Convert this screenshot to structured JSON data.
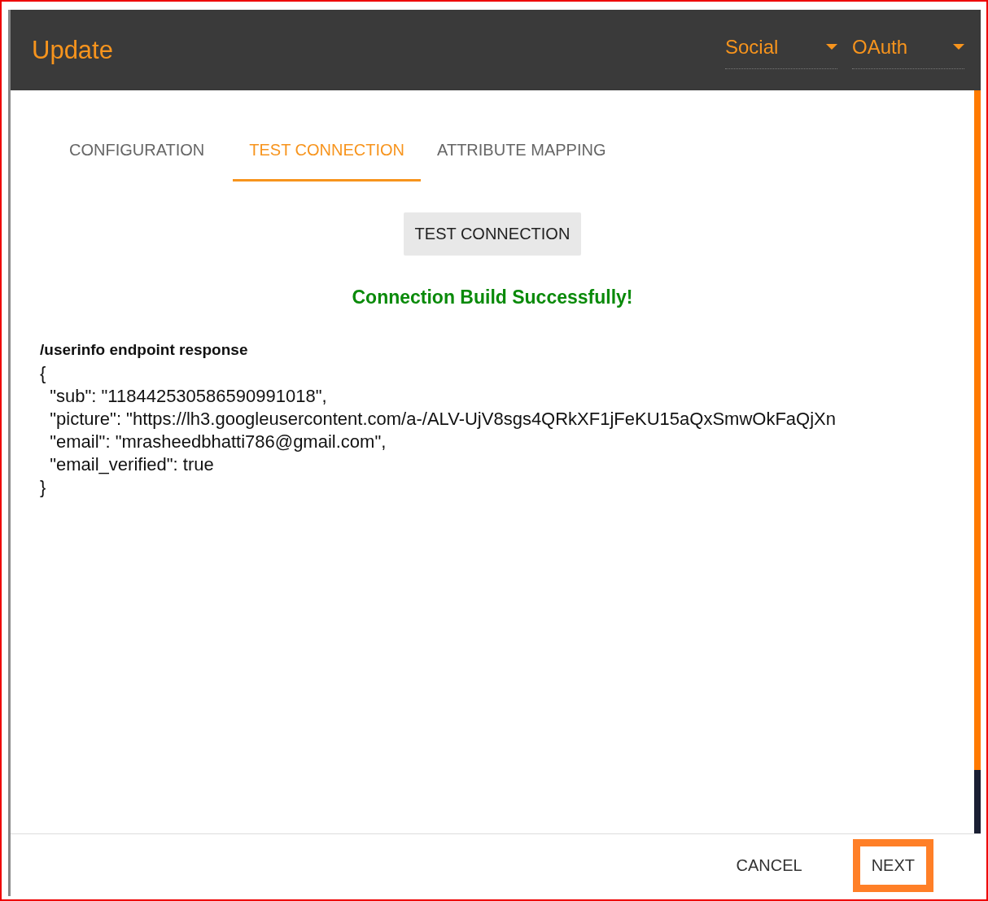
{
  "header": {
    "title": "Update",
    "dropdowns": [
      {
        "value": "Social"
      },
      {
        "value": "OAuth"
      }
    ]
  },
  "tabs": [
    {
      "label": "CONFIGURATION",
      "selected": false
    },
    {
      "label": "TEST CONNECTION",
      "selected": true
    },
    {
      "label": "ATTRIBUTE MAPPING",
      "selected": false
    }
  ],
  "test_button": "TEST CONNECTION",
  "status": "Connection Build Successfully!",
  "response": {
    "heading": "/userinfo endpoint response",
    "lines": [
      "{",
      "  \"sub\": \"118442530586590991018\",",
      "  \"picture\": \"https://lh3.googleusercontent.com/a-/ALV-UjV8sgs4QRkXF1jFeKU15aQxSmwOkFaQjXn",
      "  \"email\": \"mrasheedbhatti786@gmail.com\",",
      "  \"email_verified\": true",
      "}"
    ]
  },
  "footer": {
    "buttons": [
      {
        "label": "CANCEL",
        "highlighted": false
      },
      {
        "label": "NEXT",
        "highlighted": true
      }
    ]
  }
}
